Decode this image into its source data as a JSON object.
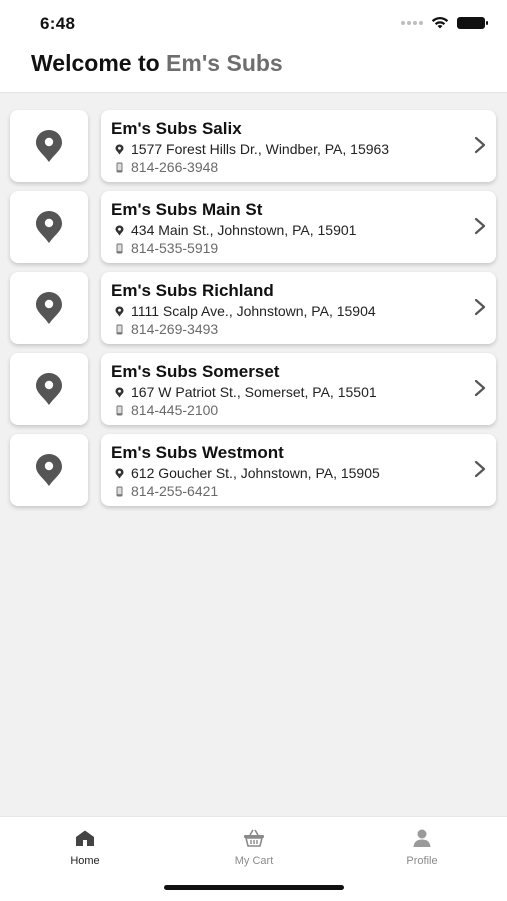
{
  "status_bar": {
    "time": "6:48"
  },
  "header": {
    "title_prefix": "Welcome to ",
    "title_brand": "Em's Subs"
  },
  "stores": [
    {
      "name": "Em's Subs Salix",
      "address": "1577 Forest Hills Dr., Windber, PA, 15963",
      "phone": "814-266-3948"
    },
    {
      "name": "Em's Subs Main St",
      "address": "434 Main St., Johnstown, PA, 15901",
      "phone": "814-535-5919"
    },
    {
      "name": "Em's Subs Richland",
      "address": "1111 Scalp Ave., Johnstown, PA, 15904",
      "phone": "814-269-3493"
    },
    {
      "name": "Em's Subs Somerset",
      "address": "167 W Patriot St., Somerset, PA, 15501",
      "phone": "814-445-2100"
    },
    {
      "name": "Em's Subs Westmont",
      "address": "612 Goucher St., Johnstown, PA, 15905",
      "phone": "814-255-6421"
    }
  ],
  "tabs": [
    {
      "label": "Home",
      "icon": "home-icon",
      "active": true
    },
    {
      "label": "My Cart",
      "icon": "basket-icon",
      "active": false
    },
    {
      "label": "Profile",
      "icon": "person-icon",
      "active": false
    }
  ],
  "colors": {
    "background": "#f1f1f1",
    "card": "#ffffff",
    "brand_accent": "#6e6e6e",
    "icon_gray": "#555555"
  }
}
